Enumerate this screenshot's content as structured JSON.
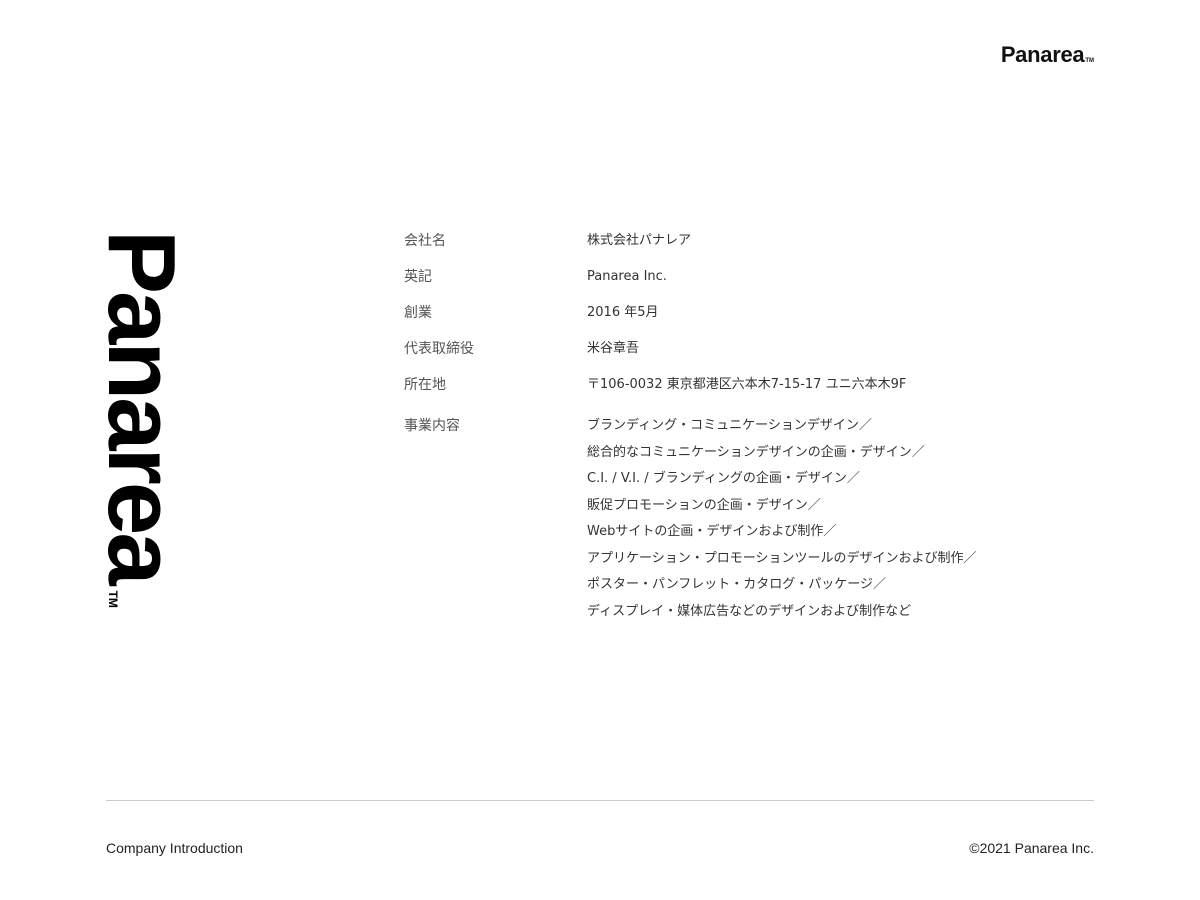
{
  "header": {
    "logo_text": "Panarea",
    "logo_tm": "TM"
  },
  "vertical_logo": {
    "text": "Panarea",
    "tm": "TM"
  },
  "company_info": [
    {
      "label": "会社名",
      "value": "株式会社パナレア"
    },
    {
      "label": "英記",
      "value": "Panarea Inc."
    },
    {
      "label": "創業",
      "value": "2016 年5月"
    },
    {
      "label": "代表取締役",
      "value": "米谷章吾"
    },
    {
      "label": "所在地",
      "value": "〒106-0032 東京都港区六本木7-15-17 ユニ六本木9F"
    }
  ],
  "business": {
    "label": "事業内容",
    "items": [
      "ブランディング・コミュニケーションデザイン／",
      "総合的なコミュニケーションデザインの企画・デザイン／",
      "C.I. / V.I. / ブランディングの企画・デザイン／",
      "販促プロモーションの企画・デザイン／",
      "Webサイトの企画・デザインおよび制作／",
      "アプリケーション・プロモーションツールのデザインおよび制作／",
      "ポスター・パンフレット・カタログ・パッケージ／",
      "ディスプレイ・媒体広告などのデザインおよび制作など"
    ]
  },
  "footer": {
    "left": "Company Introduction",
    "right": "©2021 Panarea Inc."
  }
}
